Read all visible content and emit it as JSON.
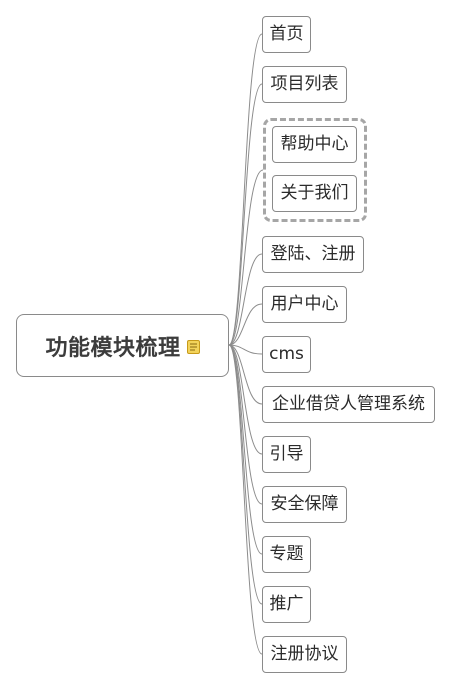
{
  "root": {
    "label": "功能模块梳理",
    "icon": "note-icon"
  },
  "branches": [
    {
      "id": "home",
      "label": "首页"
    },
    {
      "id": "project-list",
      "label": "项目列表"
    },
    {
      "id": "help-center",
      "label": "帮助中心"
    },
    {
      "id": "about-us",
      "label": "关于我们"
    },
    {
      "id": "login-register",
      "label": "登陆、注册"
    },
    {
      "id": "user-center",
      "label": "用户中心"
    },
    {
      "id": "cms",
      "label": "cms"
    },
    {
      "id": "enterprise-loan-system",
      "label": "企业借贷人管理系统"
    },
    {
      "id": "guide",
      "label": "引导"
    },
    {
      "id": "security",
      "label": "安全保障"
    },
    {
      "id": "topics",
      "label": "专题"
    },
    {
      "id": "promotion",
      "label": "推广"
    },
    {
      "id": "register-agreement",
      "label": "注册协议"
    }
  ],
  "colors": {
    "line": "#8c8c8c",
    "border": "#8a8a8a",
    "group_border": "#a6a6a6",
    "note_icon": "#e9c23a"
  }
}
